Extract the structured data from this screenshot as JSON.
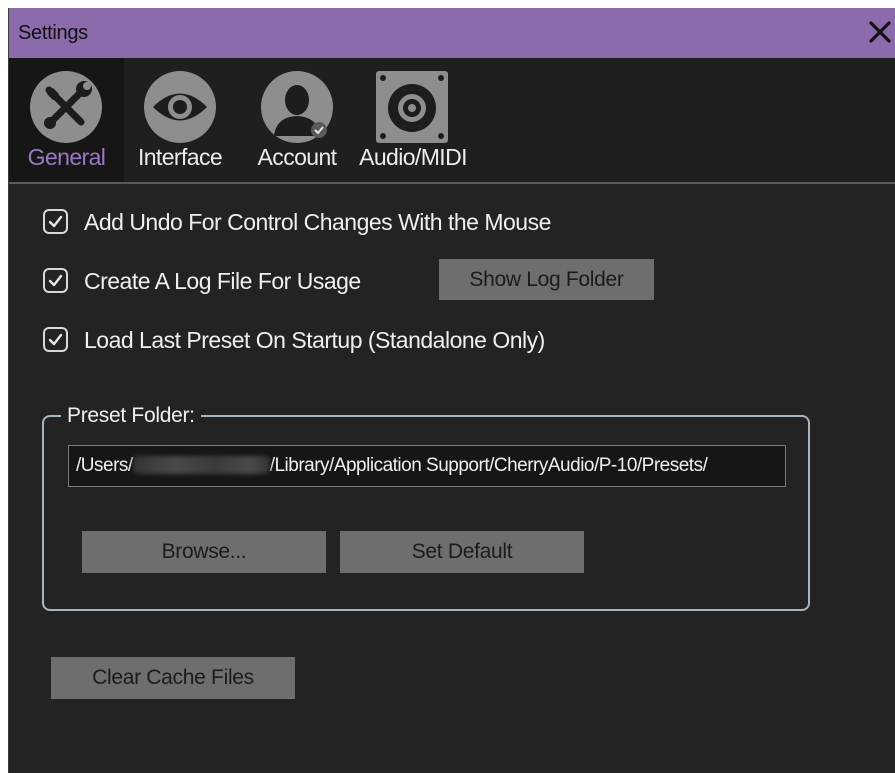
{
  "window": {
    "title": "Settings"
  },
  "tabs": [
    {
      "label": "General",
      "icon": "tools-icon",
      "active": true
    },
    {
      "label": "Interface",
      "icon": "eye-icon",
      "active": false
    },
    {
      "label": "Account",
      "icon": "user-account-icon",
      "active": false
    },
    {
      "label": "Audio/MIDI",
      "icon": "speaker-icon",
      "active": false
    }
  ],
  "general": {
    "options": [
      {
        "label": "Add Undo For Control Changes With the Mouse",
        "checked": true
      },
      {
        "label": "Create A Log File For Usage",
        "checked": true
      },
      {
        "label": "Load Last Preset On Startup (Standalone Only)",
        "checked": true
      }
    ],
    "show_log_folder_label": "Show Log Folder",
    "preset_folder": {
      "label": "Preset Folder:",
      "path_prefix": "/Users/",
      "path_suffix": "/Library/Application Support/CherryAudio/P-10/Presets/",
      "browse_label": "Browse...",
      "set_default_label": "Set Default"
    },
    "clear_cache_label": "Clear Cache Files"
  },
  "colors": {
    "titlebar": "#8c6bac",
    "active_tab_text": "#9a78c4",
    "background": "#232323",
    "button": "#6e6e6e"
  }
}
